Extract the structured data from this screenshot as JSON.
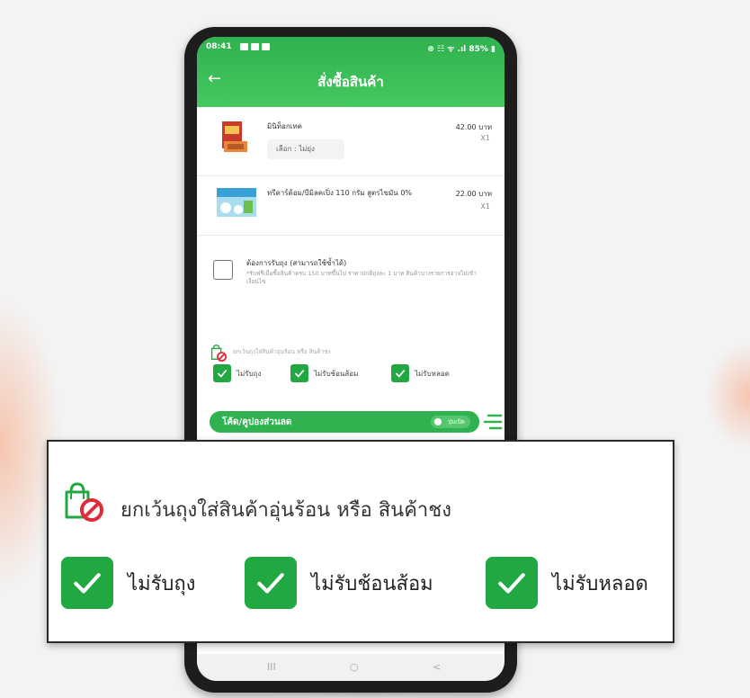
{
  "status_bar": {
    "time": "08:41",
    "right": "⊕ ☷ ᯤ .ıl 85% ▮"
  },
  "header": {
    "back_icon": "back-arrow-icon",
    "title": "สั่งซื้อสินค้า"
  },
  "products": [
    {
      "name": "มินิท็อกเทค",
      "price": "42.00 บาท",
      "qty": "X1",
      "option": "เลือก : ไม่ยุ่ง"
    },
    {
      "name": "ทรีดาร์ด้อม/บีมิลคเปิ่ง 110 กรัม สูตรไขมัน 0%",
      "price": "22.00 บาท",
      "qty": "X1"
    }
  ],
  "bag_option": {
    "title": "ต้องการรับถุง (สามารถใช้ซ้ำได้)",
    "description": "*รับฟรีเมื่อซื้อสินค้าครบ 150 บาทขึ้นไป ราคาปกติถุงละ 1 บาท สินค้าบางรายการอาจไม่เข้าเงื่อนไข"
  },
  "exclusion": {
    "text": "ยกเว้นถุงใส่สินค้าอุ่นร้อน หรือ สินค้าชง",
    "options": [
      {
        "label": "ไม่รับถุง",
        "checked": true
      },
      {
        "label": "ไม่รับช้อนส้อม",
        "checked": true
      },
      {
        "label": "ไม่รับหลอด",
        "checked": true
      }
    ]
  },
  "promo": {
    "label": "โค้ด/คูปองส่วนลด",
    "toggle_text": "ปุ่มเปิด"
  },
  "navbar": {
    "recent": "III",
    "home": "○",
    "back": "<"
  },
  "colors": {
    "primary_green": "#2fb24f",
    "check_green": "#21a842",
    "prohibit_red": "#e02b3a"
  }
}
